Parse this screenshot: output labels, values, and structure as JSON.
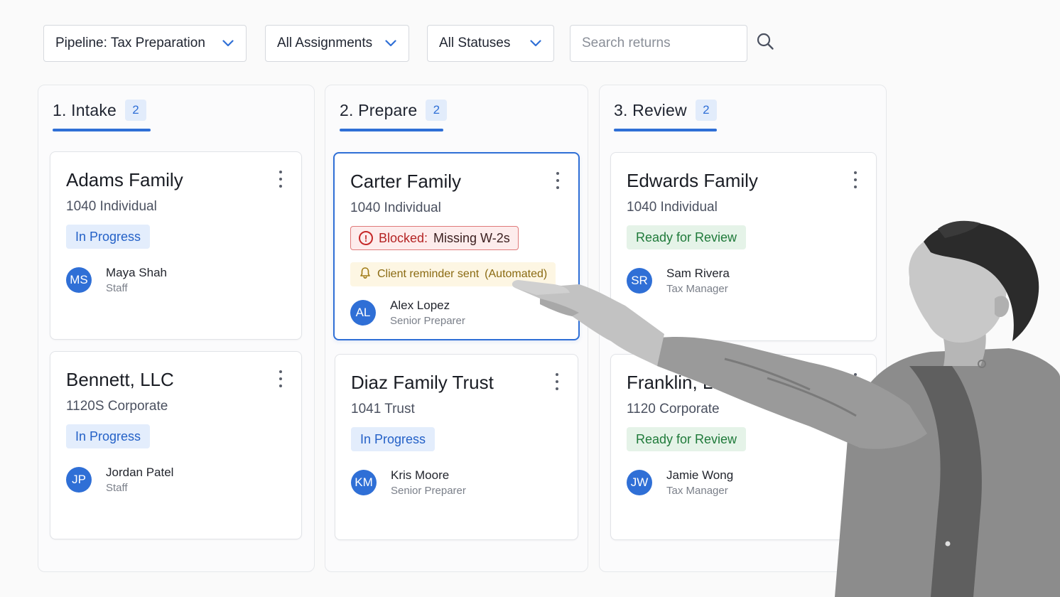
{
  "toolbar": {
    "pipeline_label": "Pipeline: Tax Preparation",
    "assignments_label": "All Assignments",
    "statuses_label": "All Statuses",
    "search_placeholder": "Search returns"
  },
  "columns": [
    {
      "title": "1. Intake",
      "count": "2",
      "cards": [
        {
          "name": "Adams Family",
          "type": "1040 Individual",
          "status": "In Progress",
          "initials": "MS",
          "assignee": "Maya Shah",
          "role": "Staff"
        },
        {
          "name": "Bennett, LLC",
          "type": "1120S Corporate",
          "status": "In Progress",
          "initials": "JP",
          "assignee": "Jordan Patel",
          "role": "Staff"
        }
      ]
    },
    {
      "title": "2. Prepare",
      "count": "2",
      "cards": [
        {
          "name": "Carter Family",
          "type": "1040 Individual",
          "status_prefix": "Blocked:",
          "status_detail": "Missing W-2s",
          "reminder": "Client reminder sent",
          "reminder_note": "(Automated)",
          "initials": "AL",
          "assignee": "Alex Lopez",
          "role": "Senior Preparer"
        },
        {
          "name": "Diaz Family Trust",
          "type": "1041 Trust",
          "status": "In Progress",
          "initials": "KM",
          "assignee": "Kris Moore",
          "role": "Senior Preparer"
        }
      ]
    },
    {
      "title": "3. Review",
      "count": "2",
      "cards": [
        {
          "name": "Edwards Family",
          "type": "1040 Individual",
          "status": "Ready for Review",
          "initials": "SR",
          "assignee": "Sam Rivera",
          "role": "Tax Manager"
        },
        {
          "name": "Franklin, LLC",
          "type": "1120 Corporate",
          "status": "Ready for Review",
          "initials": "JW",
          "assignee": "Jamie Wong",
          "role": "Tax Manager"
        }
      ]
    }
  ],
  "colors": {
    "accent": "#2f6fd6",
    "in_progress_bg": "#e3edfc",
    "ready_bg": "#e5f3e8",
    "blocked_bg": "#fdecec",
    "reminder_bg": "#fdf6e3"
  }
}
